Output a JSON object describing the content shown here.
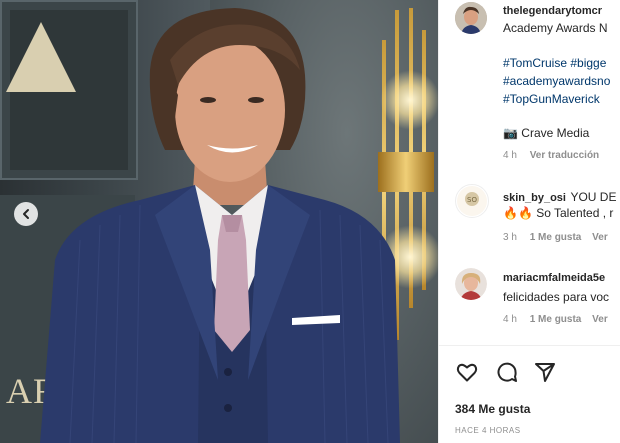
{
  "post": {
    "author": "thelegendarytomcr",
    "caption_line": "Academy Awards N",
    "hashtags": [
      "#TomCruise #bigge",
      "#academyawardsno",
      "#TopGunMaverick"
    ],
    "credit_icon": "camera-emoji",
    "credit": "Crave Media",
    "time": "4 h",
    "translate": "Ver traducción"
  },
  "photo": {
    "ars_text": "ARS"
  },
  "comments": [
    {
      "username": "skin_by_osi",
      "text": "YOU DE",
      "text2": "🔥🔥 So Talented , r",
      "time": "3 h",
      "likes_label": "1 Me gusta",
      "reply": "Ver"
    },
    {
      "username": "mariacmfalmeida5e",
      "text": "felicidades para voc",
      "time": "4 h",
      "likes_label": "1 Me gusta",
      "reply": "Ver"
    }
  ],
  "footer": {
    "likes": "384 Me gusta",
    "time_ago": "HACE 4 HORAS"
  },
  "colors": {
    "tag": "#00376b",
    "meta": "#8e8e8e",
    "text": "#262626"
  }
}
